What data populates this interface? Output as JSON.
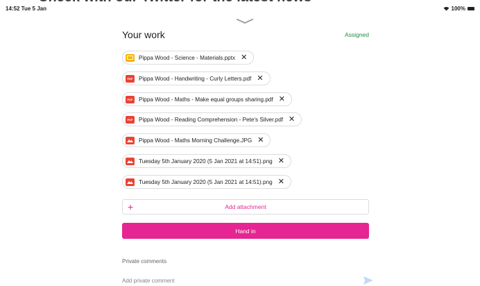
{
  "banner": {
    "text": "Check with our Twitter for the latest news"
  },
  "status": {
    "time_date": "14:52  Tue 5 Jan",
    "battery": "100%"
  },
  "your_work": {
    "title": "Your work",
    "status": "Assigned",
    "attachments": [
      {
        "name": "Pippa Wood - Science - Materials.pptx",
        "type": "slides"
      },
      {
        "name": "Pippa Wood - Handwriting - Curly Letters.pdf",
        "type": "pdf"
      },
      {
        "name": "Pippa Wood - Maths - Make equal groups sharing.pdf",
        "type": "pdf"
      },
      {
        "name": "Pippa Wood - Reading Comprehension - Pete's Silver.pdf",
        "type": "pdf"
      },
      {
        "name": "Pippa Wood - Maths Morning Challenge.JPG",
        "type": "image"
      },
      {
        "name": "Tuesday 5th January 2020 (5 Jan 2021 at 14:51).png",
        "type": "image"
      },
      {
        "name": "Tuesday 5th January 2020 (5 Jan 2021 at 14:51).png",
        "type": "image"
      }
    ],
    "remove_symbol": "✕",
    "pdf_icon_text": "PDF",
    "add_attachment": {
      "plus": "+",
      "label": "Add attachment"
    },
    "hand_in": "Hand in"
  },
  "private_comments": {
    "label": "Private comments",
    "placeholder": "Add private comment"
  },
  "colors": {
    "accent": "#e52592",
    "assigned": "#1e8e3e",
    "slides": "#f4b400",
    "pdf": "#ea4335"
  },
  "icons": [
    "wifi-icon",
    "battery-icon",
    "chevron-down-icon",
    "slides-file-icon",
    "pdf-file-icon",
    "image-file-icon",
    "close-icon",
    "plus-icon",
    "send-icon"
  ]
}
